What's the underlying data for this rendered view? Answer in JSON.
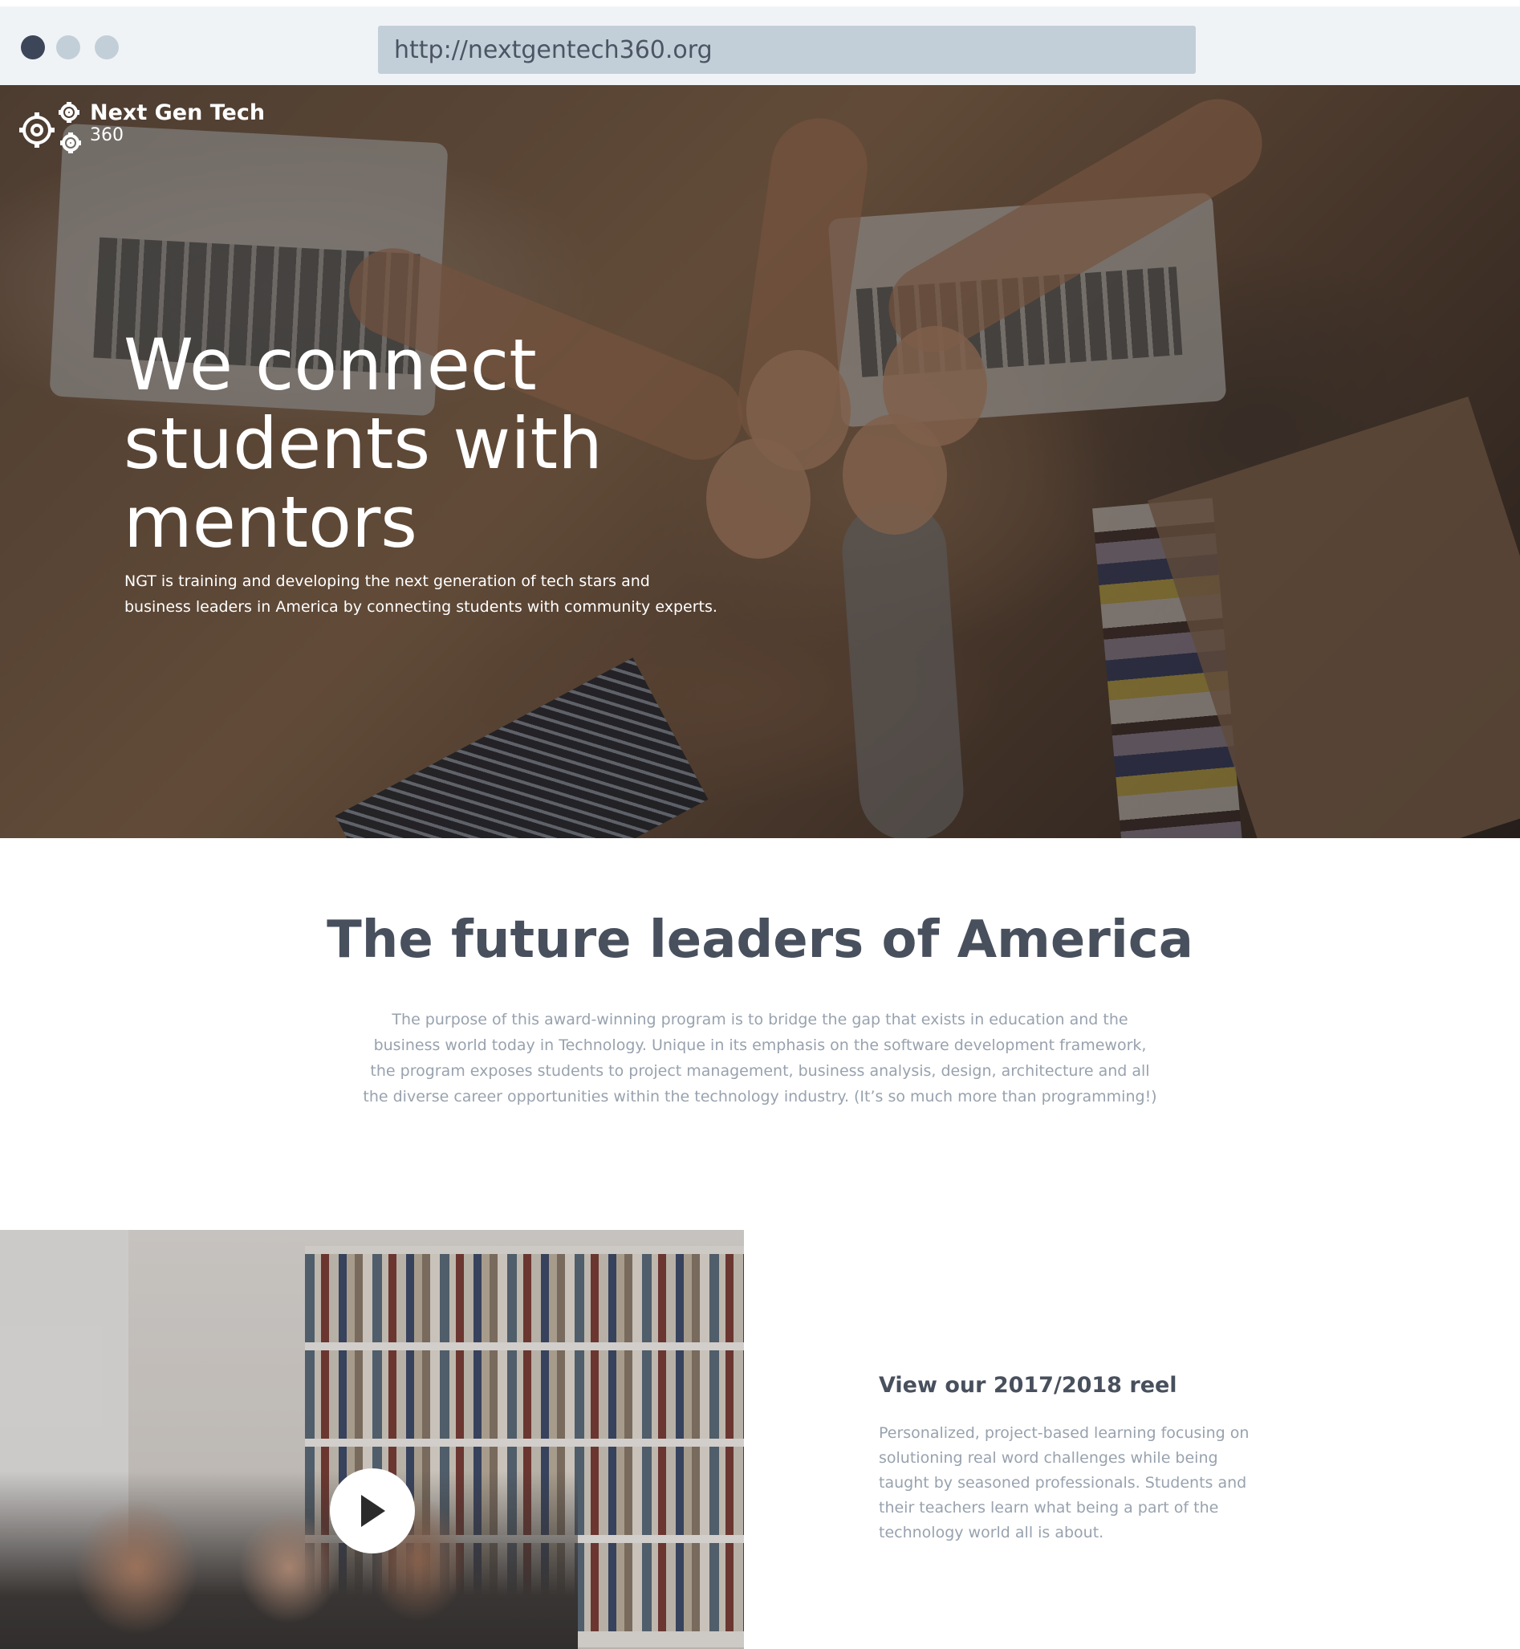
{
  "browser": {
    "url": "http://nextgentech360.org"
  },
  "header": {
    "logo_icon": "gears-icon",
    "brand_name": "Next Gen Tech",
    "brand_sub": "360"
  },
  "hero": {
    "title_line1": "We connect",
    "title_line2": "students with",
    "title_line3": "mentors",
    "text_line1": "NGT is training and developing the next generation of tech stars and",
    "text_line2": "business leaders in America by connecting students with community experts."
  },
  "about": {
    "title": "The future leaders of America",
    "line1": "The purpose of this award-winning program is to bridge the gap that exists in education and the",
    "line2": "business world today in Technology. Unique in its emphasis on the software development framework,",
    "line3": "the program exposes students to project management, business analysis, design, architecture and all",
    "line4": "the diverse career opportunities within the technology industry. (It’s so much more than programming!)"
  },
  "reel": {
    "play_icon": "play-icon",
    "title": "View our 2017/2018 reel",
    "line1": "Personalized, project-based learning focusing on",
    "line2": "solutioning real word challenges while being",
    "line3": "taught by seasoned professionals. Students and",
    "line4": "their teachers learn what being a part of the",
    "line5": "technology world all is about."
  },
  "colors": {
    "heading": "#48505d",
    "body_muted": "#98a2ae",
    "chrome_bg": "#f0f3f6",
    "urlbar_bg": "#c2cfd9"
  }
}
